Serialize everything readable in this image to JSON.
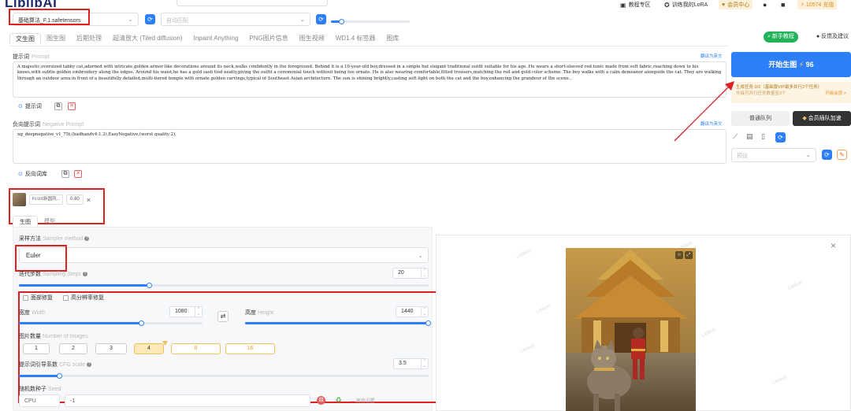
{
  "app": {
    "logo": "LiblibAI"
  },
  "model_select": {
    "value": "基础算法_F.1.safetensors"
  },
  "vae_select": {
    "placeholder": "自动匹配"
  },
  "topnav": {
    "tutorial": "教程专区",
    "train_lora": "训练我的LoRA",
    "member": "会员中心",
    "credits": "10574 充值"
  },
  "tabs": [
    "文生图",
    "图生图",
    "后期处理",
    "超清放大 (Tiled diffusion)",
    "Inpaint Anything",
    "PNG图片信息",
    "图生视频",
    "WD1.4 标签器",
    "图库"
  ],
  "beginner": {
    "label": "新手教程",
    "feedback": "反馈及建议"
  },
  "prompt": {
    "label": "提示词",
    "label_en": "Prompt",
    "translate": "翻译为英文",
    "text": "A majestic,oversized tabby cat,adorned with intricate,golden armor-like decorations around its neck,walks confidently in the foreground. Behind it is a 10-year-old boy,dressed in a simple but elegant traditional outfit suitable for his age. He wears a short-sleeved red tunic made from soft fabric,reaching down to his knees,with subtle golden embroidery along the edges. Around his waist,he has a gold sash tied neatly,giving the outfit a ceremonial touch without being too ornate. He is also wearing comfortable,fitted trousers,matching the red and gold color scheme. The boy walks with a calm demeanor alongside the cat. They are walking through an outdoor area in front of a beautifully detailed,multi-tiered temple with ornate golden carvings,typical of Southeast Asian architecture. The sun is shining brightly,casting soft light on both the cat and the boy,enhancing the grandeur of the scene.,",
    "library": "提示词"
  },
  "negative": {
    "label": "负向提示词",
    "label_en": "Negative Prompt",
    "translate": "翻译为英文",
    "text": "ng_deepnegative_v1_75t,(badhandv4:1.2),EasyNegative,(worst quality:2),",
    "library": "反向词库"
  },
  "lora": {
    "name": "FLUX新国风...",
    "weight": "0.80"
  },
  "subtabs": [
    "生图",
    "模型"
  ],
  "sampler": {
    "label": "采样方法",
    "label_en": "Sampler method",
    "value": "Euler"
  },
  "steps": {
    "label": "迭代步数",
    "label_en": "Sampling Steps",
    "value": "20",
    "fraction": 0.33
  },
  "options": {
    "face_fix": "面部修复",
    "hires": "高分辨率修复"
  },
  "width": {
    "label": "宽度",
    "label_en": "Width",
    "value": "1080",
    "fraction": 0.67
  },
  "height": {
    "label": "高度",
    "label_en": "Height",
    "value": "1440",
    "fraction": 1.0
  },
  "batch": {
    "label": "图片数量",
    "label_en": "Number of Images",
    "options": [
      "1",
      "2",
      "3",
      "4",
      "8",
      "16"
    ],
    "selected": "4"
  },
  "cfg": {
    "label": "提示词引导系数",
    "label_en": "CFG scale",
    "value": "3.5",
    "fraction": 0.1
  },
  "seed": {
    "label": "随机数种子",
    "label_en": "Seed",
    "device": "CPU",
    "value": "-1",
    "advanced": "高级设置"
  },
  "right": {
    "start": "开始生图",
    "start_cost": "96",
    "notice_line1": "生成任务 0/2（基础版VIP最多并行2个任务）",
    "notice_line2": "升级可并行任务数量至3个",
    "notice_upgrade": "升级会员 >",
    "queue_normal": "普通队列",
    "queue_vip": "会员插队加速",
    "preset_placeholder": "预设"
  },
  "colors": {
    "accent": "#2d7ff9",
    "red_box": "#e02020",
    "gold": "#f0c060"
  }
}
